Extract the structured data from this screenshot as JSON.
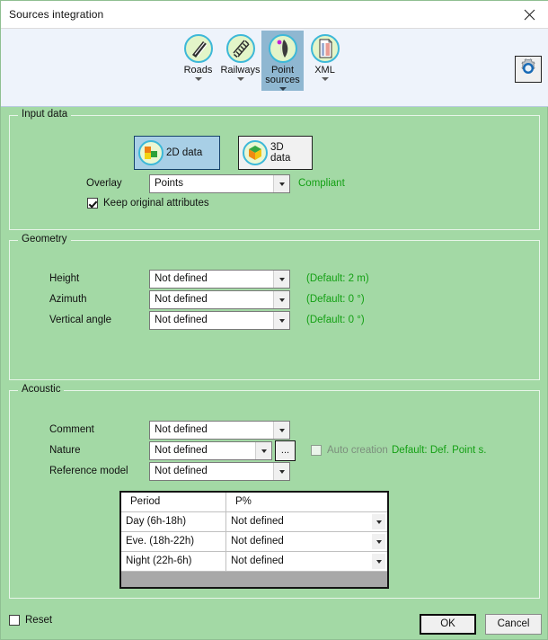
{
  "window": {
    "title": "Sources integration",
    "close_icon": "close-icon"
  },
  "toolbar": {
    "items": [
      {
        "label": "Roads",
        "icon": "roads-icon",
        "selected": false,
        "has_caret": true
      },
      {
        "label": "Railways",
        "icon": "railways-icon",
        "selected": false,
        "has_caret": true
      },
      {
        "label": "Point sources",
        "label_line1": "Point",
        "label_line2": "sources",
        "icon": "point-sources-icon",
        "selected": true,
        "has_caret": true
      },
      {
        "label": "XML",
        "icon": "xml-icon",
        "selected": false,
        "has_caret": true
      }
    ],
    "settings_button": {
      "icon": "gear-icon",
      "label": ""
    }
  },
  "input_data": {
    "legend": "Input data",
    "buttons": [
      {
        "label": "2D data",
        "icon": "2d-data-icon",
        "selected": true
      },
      {
        "label": "3D data",
        "icon": "3d-data-icon",
        "selected": false
      }
    ],
    "overlay": {
      "label": "Overlay",
      "value": "Points",
      "hint": "Compliant"
    },
    "keep_attributes": {
      "label": "Keep original attributes",
      "checked": true
    }
  },
  "geometry": {
    "legend": "Geometry",
    "rows": [
      {
        "label": "Height",
        "value": "Not defined",
        "hint": "(Default: 2 m)"
      },
      {
        "label": "Azimuth",
        "value": "Not defined",
        "hint": "(Default: 0 °)"
      },
      {
        "label": "Vertical angle",
        "value": "Not defined",
        "hint": "(Default: 0 °)"
      }
    ]
  },
  "acoustic": {
    "legend": "Acoustic",
    "rows": [
      {
        "label": "Comment",
        "value": "Not defined"
      },
      {
        "label": "Nature",
        "value": "Not defined"
      },
      {
        "label": "Reference model",
        "value": "Not defined"
      }
    ],
    "browse_button": "...",
    "auto_creation": {
      "label": "Auto creation",
      "checked": false,
      "enabled": false
    },
    "default_hint": "Default: Def. Point s.",
    "table": {
      "headers": [
        "Period",
        "P%"
      ],
      "rows": [
        {
          "period": "Day (6h-18h)",
          "value": "Not defined"
        },
        {
          "period": "Eve. (18h-22h)",
          "value": "Not defined"
        },
        {
          "period": "Night (22h-6h)",
          "value": "Not defined"
        }
      ]
    }
  },
  "footer": {
    "reset": {
      "label": "Reset",
      "checked": false
    },
    "ok": "OK",
    "cancel": "Cancel"
  },
  "colors": {
    "panel_green": "#a3d9a5",
    "toolbar_blue": "#eef3fb",
    "selection_blue": "#8fb7d1",
    "hint_green": "#14a014",
    "icon_ring": "#3db8d8"
  }
}
